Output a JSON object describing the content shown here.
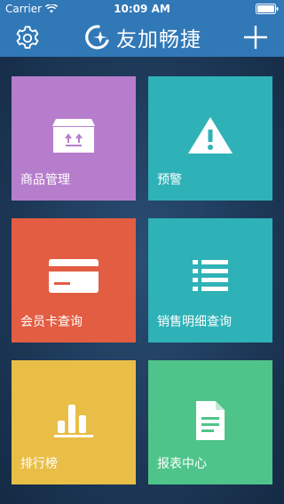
{
  "status_bar": {
    "carrier": "Carrier",
    "time": "10:09 AM"
  },
  "nav": {
    "title": "友加畅捷",
    "settings_icon": "gear-icon",
    "add_icon": "plus-icon"
  },
  "tiles": [
    {
      "label": "商品管理",
      "icon": "box-icon",
      "color": "#b77dcd"
    },
    {
      "label": "预警",
      "icon": "warning-icon",
      "color": "#2fb2b7"
    },
    {
      "label": "会员卡查询",
      "icon": "card-icon",
      "color": "#e35d43"
    },
    {
      "label": "销售明细查询",
      "icon": "list-icon",
      "color": "#2fb2b7"
    },
    {
      "label": "排行榜",
      "icon": "bar-chart-icon",
      "color": "#e8be46"
    },
    {
      "label": "报表中心",
      "icon": "document-icon",
      "color": "#4fc48a"
    }
  ]
}
